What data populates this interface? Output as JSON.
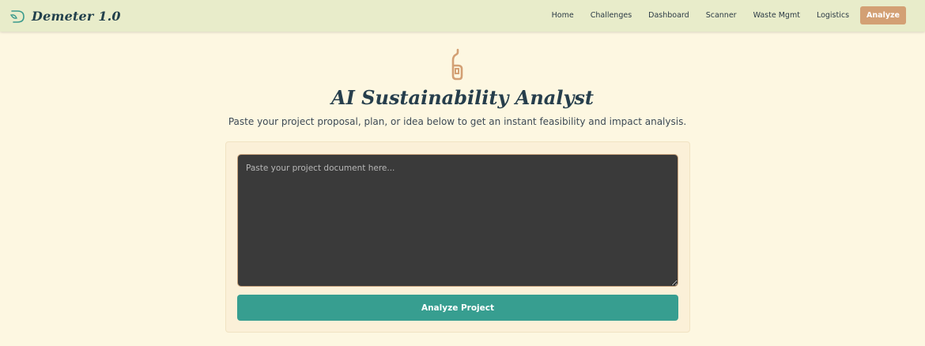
{
  "app": {
    "brand_name": "Demeter 1.0",
    "brand_icon": "leaf-d-logo-icon"
  },
  "nav": {
    "items": [
      {
        "label": "Home",
        "active": false
      },
      {
        "label": "Challenges",
        "active": false
      },
      {
        "label": "Dashboard",
        "active": false
      },
      {
        "label": "Scanner",
        "active": false
      },
      {
        "label": "Waste Mgmt",
        "active": false
      },
      {
        "label": "Logistics",
        "active": false
      },
      {
        "label": "Analyze",
        "active": true
      }
    ]
  },
  "main": {
    "hero_icon": "bottle-icon",
    "title": "AI Sustainability Analyst",
    "subtitle": "Paste your project proposal, plan, or idea below to get an instant feasibility and impact analysis.",
    "document_input": {
      "value": "",
      "placeholder": "Paste your project document here..."
    },
    "analyze_button_label": "Analyze Project"
  },
  "colors": {
    "background": "#fdf7e1",
    "navbar": "#e8ecca",
    "active_nav": "#d3a074",
    "primary_button": "#379e90",
    "textarea_bg": "#3a3a3a",
    "icon_accent": "#d3a074"
  }
}
